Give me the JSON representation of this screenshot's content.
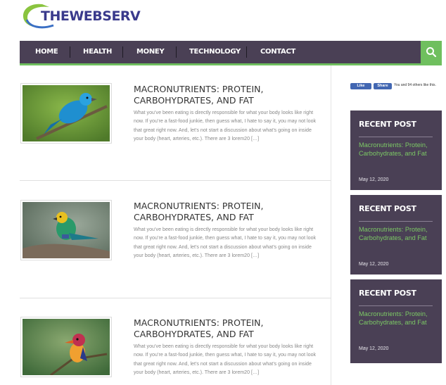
{
  "brand": {
    "logo_text": "THEWEBSERV",
    "accent": "#6fbf5e",
    "nav_bg": "#4a4055"
  },
  "nav": {
    "items": [
      {
        "label": "HOME"
      },
      {
        "label": "HEALTH"
      },
      {
        "label": "MONEY"
      },
      {
        "label": "TECHNOLOGY"
      },
      {
        "label": "CONTACT"
      }
    ],
    "search_icon": "search-icon"
  },
  "posts": [
    {
      "image": "blue-bird-photo",
      "title": "MACRONUTRIENTS: PROTEIN, CARBOHYDRATES, AND FAT",
      "excerpt": "What you’ve been eating is directly responsible for what your body looks like right now. If you’re a fast-food junkie, then guess what, I hate to say it, you may not look that great right now. And, let’s not start a discussion about what’s going on inside your body (heart, arteries, etc.). There are 3 lorem20 […]"
    },
    {
      "image": "green-bird-photo",
      "title": "MACRONUTRIENTS: PROTEIN, CARBOHYDRATES, AND FAT",
      "excerpt": "What you’ve been eating is directly responsible for what your body looks like right now. If you’re a fast-food junkie, then guess what, I hate to say it, you may not look that great right now. And, let’s not start a discussion about what’s going on inside your body (heart, arteries, etc.). There are 3 lorem20 […]"
    },
    {
      "image": "kingfisher-photo",
      "title": "MACRONUTRIENTS: PROTEIN, CARBOHYDRATES, AND FAT",
      "excerpt": "What you’ve been eating is directly responsible for what your body looks like right now. If you’re a fast-food junkie, then guess what, I hate to say it, you may not look that great right now. And, let’s not start a discussion about what’s going on inside your body (heart, arteries, etc.). There are 3 lorem20 […]"
    }
  ],
  "social": {
    "like_label": "Like",
    "share_label": "Share",
    "count_text": "You and 94 others like this."
  },
  "widgets": [
    {
      "title": "RECENT POST",
      "link": "Macronutrients: Protein, Carbohydrates, and Fat",
      "date": "May 12, 2020"
    },
    {
      "title": "RECENT POST",
      "link": "Macronutrients: Protein, Carbohydrates, and Fat",
      "date": "May 12, 2020"
    },
    {
      "title": "RECENT POST",
      "link": "Macronutrients: Protein, Carbohydrates, and Fat",
      "date": "May 12, 2020"
    }
  ]
}
